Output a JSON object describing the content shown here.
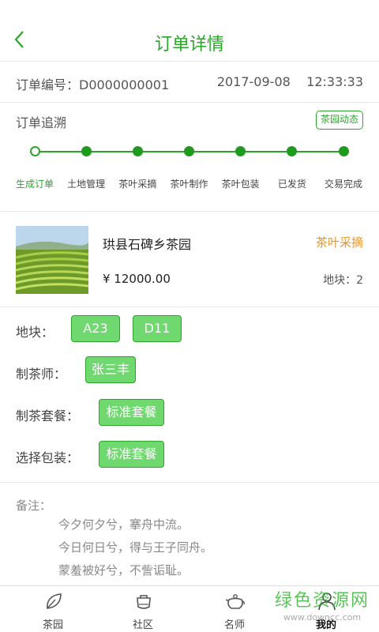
{
  "header": {
    "title": "订单详情"
  },
  "order": {
    "number_label": "订单编号：D0000000001",
    "datetime": "2017-09-08    12:33:33"
  },
  "trace": {
    "title": "订单追溯",
    "news_button": "茶园动态",
    "steps": [
      "生成订单",
      "土地管理",
      "茶叶采摘",
      "茶叶制作",
      "茶叶包装",
      "已发货",
      "交易完成"
    ],
    "active_step": 0
  },
  "product": {
    "name": "珙县石碑乡茶园",
    "status": "茶叶采摘",
    "price": "¥ 12000.00",
    "plots": "地块：2"
  },
  "options": {
    "plot_label": "地块：",
    "plots": [
      "A23",
      "D11"
    ],
    "maker_label": "制茶师：",
    "maker": "张三丰",
    "package_label": "制茶套餐：",
    "package": "标准套餐",
    "packing_label": "选择包装：",
    "packing": "标准套餐"
  },
  "notes": {
    "label": "备注：",
    "lines": [
      "今夕何夕兮，搴舟中流。",
      "今日何日兮，得与王子同舟。",
      "蒙羞被好兮，不訾诟耻。"
    ]
  },
  "tabbar": {
    "tabs": [
      {
        "label": "茶园",
        "icon": "leaf-icon"
      },
      {
        "label": "社区",
        "icon": "pot-icon"
      },
      {
        "label": "名师",
        "icon": "teapot-icon"
      },
      {
        "label": "我的",
        "icon": "user-icon"
      }
    ],
    "active": 3
  },
  "watermark": {
    "cn": "绿色资源网",
    "en": "www.downcc.com"
  },
  "colors": {
    "brand_green": "#2aa52a",
    "chip_fill": "#6fd86f",
    "status_orange": "#e8962b"
  }
}
